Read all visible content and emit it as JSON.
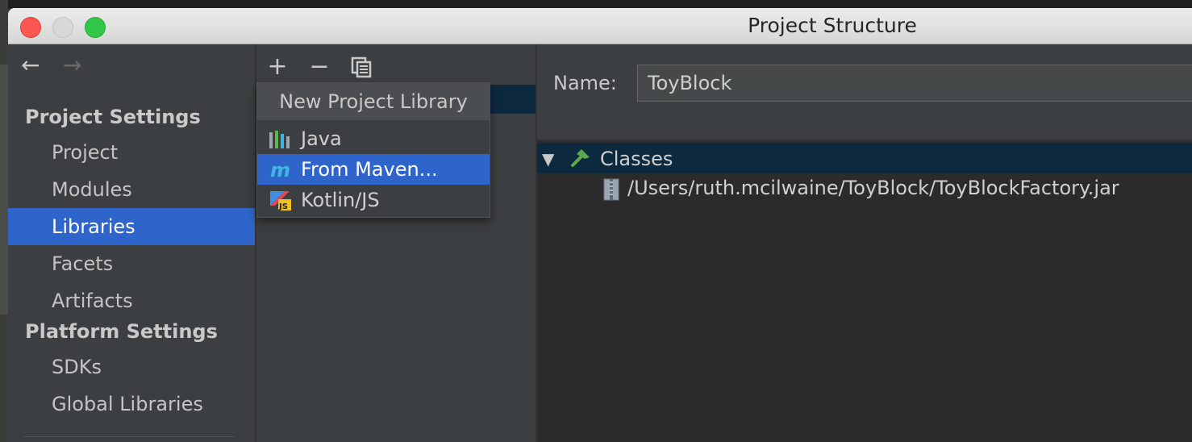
{
  "window": {
    "title": "Project Structure"
  },
  "sidebar": {
    "back_glyph": "←",
    "forward_glyph": "→",
    "sections": [
      {
        "header": "Project Settings",
        "items": [
          "Project",
          "Modules",
          "Libraries",
          "Facets",
          "Artifacts"
        ]
      },
      {
        "header": "Platform Settings",
        "items": [
          "SDKs",
          "Global Libraries"
        ]
      }
    ],
    "selected": "Libraries"
  },
  "toolbar": {
    "add_glyph": "+",
    "remove_glyph": "−"
  },
  "popup": {
    "title": "New Project Library",
    "items": [
      {
        "label": "Java",
        "icon": "java-library-icon"
      },
      {
        "label": "From Maven...",
        "icon": "maven-icon",
        "selected": true
      },
      {
        "label": "Kotlin/JS",
        "icon": "kotlin-js-icon"
      }
    ]
  },
  "detail": {
    "name_label": "Name:",
    "name_value": "ToyBlock",
    "tree": {
      "expand_glyph": "▼",
      "root_label": "Classes",
      "root_icon": "hammer-icon",
      "children": [
        {
          "label": "/Users/ruth.mcilwaine/ToyBlock/ToyBlockFactory.jar",
          "icon": "jar-icon"
        }
      ]
    }
  },
  "colors": {
    "selection": "#2f65ca",
    "tree_selection": "#0d293e",
    "panel": "#3c3f41",
    "tree_bg": "#2b2b2b"
  }
}
